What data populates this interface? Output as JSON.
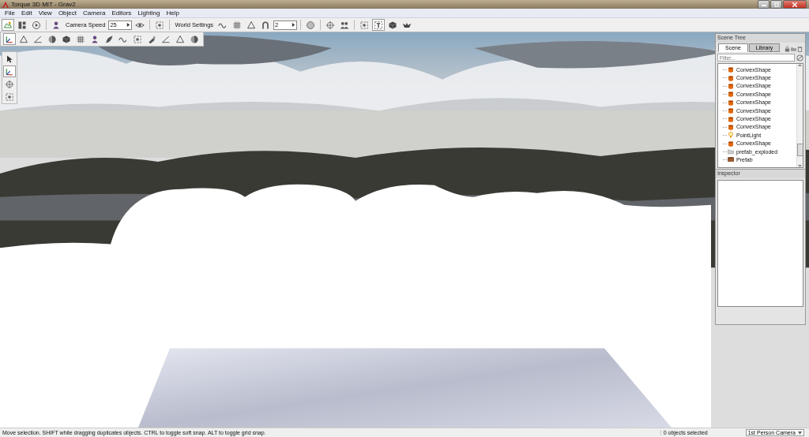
{
  "window": {
    "title": "Torque 3D MIT - Grav2"
  },
  "menu": [
    "File",
    "Edit",
    "View",
    "Object",
    "Camera",
    "Editors",
    "Lighting",
    "Help"
  ],
  "toolbar": {
    "items": [
      {
        "kind": "world",
        "selected": true
      },
      {
        "kind": "panels",
        "selected": false
      },
      {
        "kind": "play",
        "selected": false
      },
      {
        "kind": "sep"
      },
      {
        "kind": "person",
        "selected": false
      },
      {
        "kind": "label",
        "text": "Camera Speed"
      },
      {
        "kind": "field",
        "value": "25"
      },
      {
        "kind": "eye",
        "selected": false
      },
      {
        "kind": "sep"
      },
      {
        "kind": "frame",
        "selected": false
      },
      {
        "kind": "sep"
      },
      {
        "kind": "label",
        "text": "World Settings"
      },
      {
        "kind": "wave",
        "selected": false
      },
      {
        "kind": "grid",
        "selected": false
      },
      {
        "kind": "triangle",
        "selected": false
      },
      {
        "kind": "magnet",
        "selected": false
      },
      {
        "kind": "field",
        "value": "2"
      },
      {
        "kind": "sep"
      },
      {
        "kind": "circle",
        "selected": false
      },
      {
        "kind": "sep"
      },
      {
        "kind": "target",
        "selected": false
      },
      {
        "kind": "people",
        "selected": false
      },
      {
        "kind": "sep"
      },
      {
        "kind": "frame",
        "selected": false
      },
      {
        "kind": "text",
        "selected": true
      },
      {
        "kind": "cube",
        "selected": false
      },
      {
        "kind": "bird",
        "selected": false
      }
    ]
  },
  "object_bar": [
    {
      "kind": "axes",
      "selected": true
    },
    {
      "kind": "triangle",
      "selected": false
    },
    {
      "kind": "angle",
      "selected": false
    },
    {
      "kind": "sphere",
      "selected": false
    },
    {
      "kind": "cube",
      "selected": false
    },
    {
      "kind": "grid",
      "selected": false
    },
    {
      "kind": "person",
      "selected": false
    },
    {
      "kind": "leaf",
      "selected": false
    },
    {
      "kind": "wave",
      "selected": false
    },
    {
      "kind": "frame",
      "selected": false
    },
    {
      "kind": "brush",
      "selected": false
    },
    {
      "kind": "angle",
      "selected": false
    },
    {
      "kind": "triangle",
      "selected": false
    },
    {
      "kind": "sphere",
      "selected": false
    }
  ],
  "palette": [
    {
      "kind": "arrow",
      "selected": false
    },
    {
      "kind": "axes",
      "selected": true
    },
    {
      "kind": "target",
      "selected": false
    },
    {
      "kind": "frame",
      "selected": false
    }
  ],
  "scene_tree": {
    "title": "Scene Tree",
    "tabs": [
      {
        "label": "Scene",
        "selected": true
      },
      {
        "label": "Library",
        "selected": false
      }
    ],
    "filter": {
      "placeholder": "Filter..."
    },
    "items": [
      {
        "kind": "convex",
        "label": "ConvexShape"
      },
      {
        "kind": "convex",
        "label": "ConvexShape"
      },
      {
        "kind": "convex",
        "label": "ConvexShape"
      },
      {
        "kind": "convex",
        "label": "ConvexShape"
      },
      {
        "kind": "convex",
        "label": "ConvexShape"
      },
      {
        "kind": "convex",
        "label": "ConvexShape"
      },
      {
        "kind": "convex",
        "label": "ConvexShape"
      },
      {
        "kind": "convex",
        "label": "ConvexShape"
      },
      {
        "kind": "light",
        "label": "PointLight"
      },
      {
        "kind": "convex",
        "label": "ConvexShape"
      },
      {
        "kind": "folder",
        "label": "prefab_exploded"
      },
      {
        "kind": "prefab",
        "label": "Prefab"
      }
    ]
  },
  "inspector": {
    "title": "Inspector"
  },
  "status_bar": {
    "message": "Move selection.  SHIFT while dragging duplicates objects.  CTRL to toggle soft snap.  ALT to toggle grid snap.",
    "selection": "0 objects selected",
    "camera": "1st Person Camera"
  }
}
